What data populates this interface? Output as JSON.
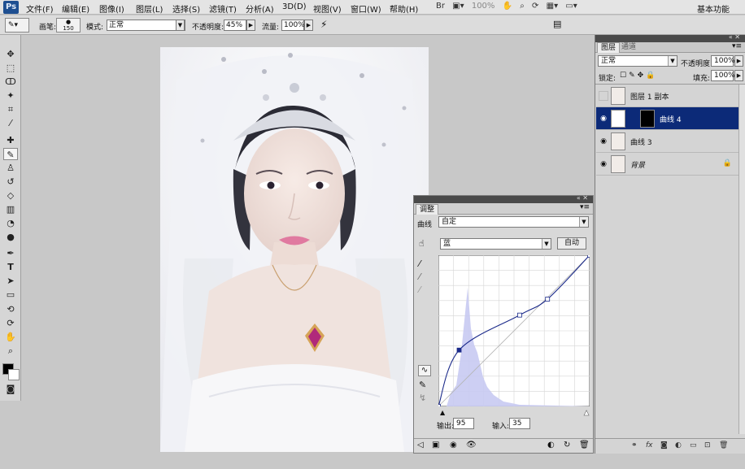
{
  "app": {
    "logo": "Ps"
  },
  "menu": [
    "文件(F)",
    "编辑(E)",
    "图像(I)",
    "图层(L)",
    "选择(S)",
    "滤镜(T)",
    "分析(A)",
    "3D(D)",
    "视图(V)",
    "窗口(W)",
    "帮助(H)"
  ],
  "menu_extra": [
    "Br",
    "100%"
  ],
  "workspace": "基本功能",
  "options": {
    "brush_label": "画笔:",
    "brush_size": "150",
    "mode_label": "模式:",
    "mode_value": "正常",
    "opacity_label": "不透明度:",
    "opacity_value": "45%",
    "flow_label": "流量:",
    "flow_value": "100%"
  },
  "adjustments": {
    "tab": "调整",
    "type_label": "曲线",
    "preset": "自定",
    "channel": "蓝",
    "auto_button": "自动",
    "output_label": "输出:",
    "output_value": "95",
    "input_label": "输入:",
    "input_value": "35"
  },
  "layers_panel": {
    "tabs": [
      "图层",
      "通道"
    ],
    "blend_mode": "正常",
    "opacity_label": "不透明度:",
    "opacity_value": "100%",
    "lock_label": "锁定:",
    "fill_label": "填充:",
    "fill_value": "100%",
    "layers": [
      {
        "name": "图层 1 副本"
      },
      {
        "name": "曲线 4"
      },
      {
        "name": "曲线 3"
      },
      {
        "name": "背景"
      }
    ]
  },
  "icons": {
    "tools": [
      "move-icon",
      "marquee-icon",
      "lasso-icon",
      "magic-wand-icon",
      "crop-icon",
      "eyedropper-icon",
      "healing-brush-icon",
      "brush-icon",
      "clone-stamp-icon",
      "history-brush-icon",
      "eraser-icon",
      "gradient-icon",
      "blur-icon",
      "dodge-icon",
      "pen-icon",
      "type-icon",
      "path-select-icon",
      "shape-icon",
      "3d-rotate-icon",
      "3d-orbit-icon",
      "hand-icon",
      "zoom-icon"
    ]
  },
  "chart_data": {
    "type": "line",
    "title": "",
    "series": [
      {
        "values": [
          [
            0,
            0
          ],
          [
            35,
            95
          ],
          [
            137,
            154
          ],
          [
            184,
            181
          ],
          [
            255,
            255
          ]
        ]
      }
    ],
    "xlim": [
      0,
      255
    ],
    "ylim": [
      0,
      255
    ]
  }
}
